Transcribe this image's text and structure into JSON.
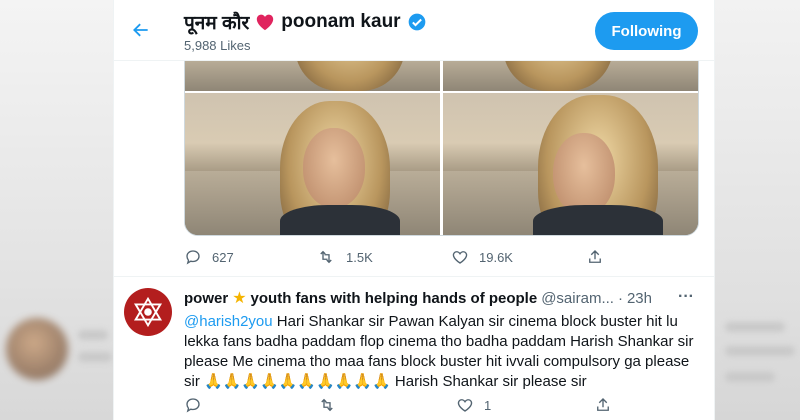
{
  "header": {
    "title_hindi": "पूनम कौर",
    "title_latin": "poonam kaur",
    "likes": "5,988 Likes",
    "follow_label": "Following"
  },
  "tweet1": {
    "actions": {
      "reply_count": "627",
      "retweet_count": "1.5K",
      "like_count": "19.6K"
    }
  },
  "tweet2": {
    "name": "power",
    "name_rest": "youth fans with helping hands of people",
    "handle": "@sairam...",
    "dot": "·",
    "time": "23h",
    "more": "···",
    "mention": "@harish2you",
    "text": " Hari Shankar sir Pawan Kalyan sir cinema block buster hit lu lekka fans badha paddam flop cinema tho badha paddam  Harish Shankar sir please Me cinema tho maa fans block buster hit ivvali compulsory ga please sir 🙏🙏🙏🙏🙏🙏🙏🙏🙏🙏  Harish Shankar sir please sir",
    "actions": {
      "like_count": "1"
    }
  },
  "colors": {
    "accent": "#1d9bf0",
    "heart": "#e0245e",
    "verified": "#1d9bf0",
    "avatar_bg": "#b31e1e"
  },
  "icons": [
    "back-arrow-icon",
    "heart-icon",
    "verified-badge-icon",
    "reply-icon",
    "retweet-icon",
    "like-icon",
    "share-icon",
    "star-icon",
    "more-icon"
  ]
}
